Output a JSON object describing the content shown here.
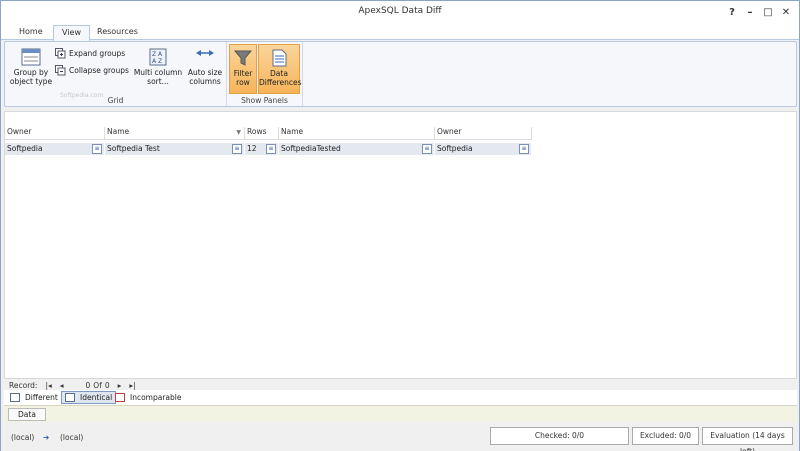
{
  "window": {
    "title": "ApexSQL Data Diff"
  },
  "window_buttons": [
    "?",
    "–",
    "□",
    "✕"
  ],
  "tabs": [
    {
      "label": "Home"
    },
    {
      "label": "View"
    },
    {
      "label": "Resources"
    }
  ],
  "ribbon": {
    "grid_group": {
      "label": "Grid",
      "group_by": "Group by object type",
      "expand": "Expand groups",
      "collapse": "Collapse groups",
      "multi_sort": "Multi column sort...",
      "auto_size": "Auto size columns"
    },
    "panels_group": {
      "label": "Show Panels",
      "filter_row": "Filter row",
      "data_diff": "Data Differences"
    },
    "watermark": "Softpedia.com"
  },
  "grid": {
    "columns": [
      "Owner",
      "Name",
      "Rows",
      "Name",
      "Owner"
    ],
    "rows": [
      [
        "Softpedia",
        "Softpedia Test",
        "12",
        "SoftpediaTested",
        "Softpedia"
      ]
    ],
    "cell_icon": "≡"
  },
  "record_nav": {
    "label": "Record:",
    "current": "0",
    "of_label": "Of",
    "total": "0"
  },
  "filter_tabs": [
    {
      "label": "Different"
    },
    {
      "label": "Identical"
    },
    {
      "label": "Incomparable"
    }
  ],
  "data_panel": {
    "tab": "Data"
  },
  "status": {
    "source": "(local)",
    "arrow": "➔",
    "target": "(local)",
    "checked": "Checked: 0/0",
    "excluded": "Excluded: 0/0",
    "evaluation": "Evaluation (14 days left)"
  },
  "colors": {
    "accent": "#f6b45a",
    "border": "#b7c9e2",
    "selected_row": "#e4e8ef"
  }
}
